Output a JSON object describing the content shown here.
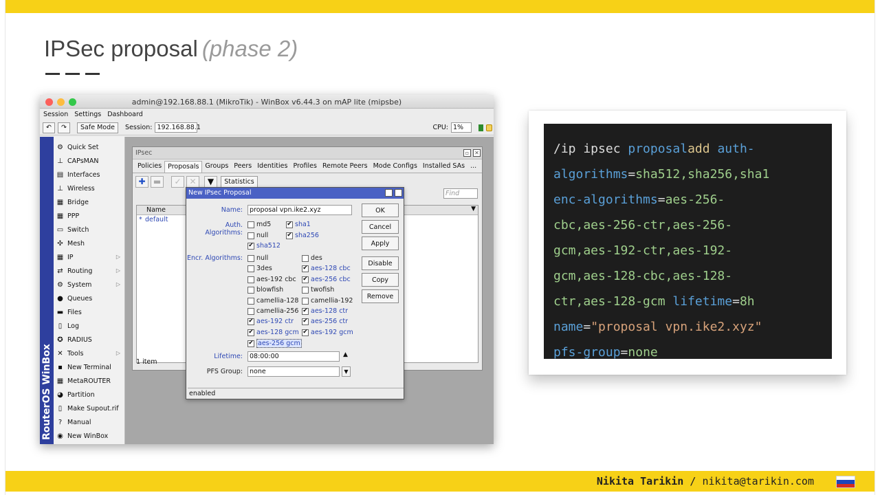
{
  "slide": {
    "title": "IPSec proposal",
    "subtitle": "(phase 2)",
    "footer_name": "Nikita Tarikin",
    "footer_sep": " / ",
    "footer_email": "nikita@tarikin.com",
    "accent_color": "#f7d117",
    "flag_colors": [
      "#ffffff",
      "#1c45b8",
      "#d52b1e"
    ]
  },
  "winbox": {
    "title": "admin@192.168.88.1 (MikroTik) - WinBox v6.44.3 on mAP lite (mipsbe)",
    "menu": [
      "Session",
      "Settings",
      "Dashboard"
    ],
    "safe_mode": "Safe Mode",
    "session_label": "Session:",
    "session_value": "192.168.88.1",
    "cpu_label": "CPU:",
    "cpu_value": "1%",
    "sidebar_brand": "RouterOS WinBox",
    "sidebar_items": [
      {
        "label": "Quick Set",
        "icon": "quickset-icon",
        "glyph": "⚙",
        "arrow": false
      },
      {
        "label": "CAPsMAN",
        "icon": "capsman-icon",
        "glyph": "⊥",
        "arrow": false
      },
      {
        "label": "Interfaces",
        "icon": "interfaces-icon",
        "glyph": "▤",
        "arrow": false
      },
      {
        "label": "Wireless",
        "icon": "wireless-icon",
        "glyph": "⊥",
        "arrow": false
      },
      {
        "label": "Bridge",
        "icon": "bridge-icon",
        "glyph": "▦",
        "arrow": false
      },
      {
        "label": "PPP",
        "icon": "ppp-icon",
        "glyph": "▦",
        "arrow": false
      },
      {
        "label": "Switch",
        "icon": "switch-icon",
        "glyph": "▭",
        "arrow": false
      },
      {
        "label": "Mesh",
        "icon": "mesh-icon",
        "glyph": "✣",
        "arrow": false
      },
      {
        "label": "IP",
        "icon": "ip-icon",
        "glyph": "▦",
        "arrow": true
      },
      {
        "label": "Routing",
        "icon": "routing-icon",
        "glyph": "⇄",
        "arrow": true
      },
      {
        "label": "System",
        "icon": "system-icon",
        "glyph": "⚙",
        "arrow": true
      },
      {
        "label": "Queues",
        "icon": "queues-icon",
        "glyph": "●",
        "arrow": false
      },
      {
        "label": "Files",
        "icon": "files-icon",
        "glyph": "▬",
        "arrow": false
      },
      {
        "label": "Log",
        "icon": "log-icon",
        "glyph": "▯",
        "arrow": false
      },
      {
        "label": "RADIUS",
        "icon": "radius-icon",
        "glyph": "✪",
        "arrow": false
      },
      {
        "label": "Tools",
        "icon": "tools-icon",
        "glyph": "✕",
        "arrow": true
      },
      {
        "label": "New Terminal",
        "icon": "terminal-icon",
        "glyph": "▪",
        "arrow": false
      },
      {
        "label": "MetaROUTER",
        "icon": "metarouter-icon",
        "glyph": "▦",
        "arrow": false
      },
      {
        "label": "Partition",
        "icon": "partition-icon",
        "glyph": "◕",
        "arrow": false
      },
      {
        "label": "Make Supout.rif",
        "icon": "supout-icon",
        "glyph": "▯",
        "arrow": false
      },
      {
        "label": "Manual",
        "icon": "manual-icon",
        "glyph": "?",
        "arrow": false
      },
      {
        "label": "New WinBox",
        "icon": "newwinbox-icon",
        "glyph": "◉",
        "arrow": false
      }
    ]
  },
  "ipsec": {
    "title": "IPsec",
    "tabs": [
      "Policies",
      "Proposals",
      "Groups",
      "Peers",
      "Identities",
      "Profiles",
      "Remote Peers",
      "Mode Configs",
      "Installed SAs",
      "..."
    ],
    "active_tab": "Proposals",
    "statistics": "Statistics",
    "find_placeholder": "Find",
    "col_name": "Name",
    "row_marker": "*",
    "row_name": "default",
    "count": "1 item"
  },
  "dialog": {
    "title": "New IPsec Proposal",
    "name_label": "Name:",
    "name_value": "proposal vpn.ike2.xyz",
    "auth_label": "Auth. Algorithms:",
    "auth": [
      {
        "label": "md5",
        "checked": false
      },
      {
        "label": "sha1",
        "checked": true
      },
      {
        "label": "null",
        "checked": false
      },
      {
        "label": "sha256",
        "checked": true
      },
      {
        "label": "sha512",
        "checked": true
      }
    ],
    "encr_label": "Encr. Algorithms:",
    "encr": [
      {
        "label": "null",
        "checked": false
      },
      {
        "label": "des",
        "checked": false
      },
      {
        "label": "3des",
        "checked": false
      },
      {
        "label": "aes-128 cbc",
        "checked": true
      },
      {
        "label": "aes-192 cbc",
        "checked": false
      },
      {
        "label": "aes-256 cbc",
        "checked": true
      },
      {
        "label": "blowfish",
        "checked": false
      },
      {
        "label": "twofish",
        "checked": false
      },
      {
        "label": "camellia-128",
        "checked": false
      },
      {
        "label": "camellia-192",
        "checked": false
      },
      {
        "label": "camellia-256",
        "checked": false
      },
      {
        "label": "aes-128 ctr",
        "checked": true
      },
      {
        "label": "aes-192 ctr",
        "checked": true
      },
      {
        "label": "aes-256 ctr",
        "checked": true
      },
      {
        "label": "aes-128 gcm",
        "checked": true
      },
      {
        "label": "aes-192 gcm",
        "checked": true
      },
      {
        "label": "aes-256 gcm",
        "checked": true
      }
    ],
    "lifetime_label": "Lifetime:",
    "lifetime_value": "08:00:00",
    "pfs_label": "PFS Group:",
    "pfs_value": "none",
    "buttons": [
      "OK",
      "Cancel",
      "Apply",
      "Disable",
      "Copy",
      "Remove"
    ],
    "status": "enabled"
  },
  "code": {
    "lines": [
      [
        {
          "t": "/ip ipsec ",
          "c": "kw"
        },
        {
          "t": "proposal",
          "c": "prop"
        },
        {
          "t": "add ",
          "c": "gold"
        },
        {
          "t": "auth-",
          "c": "prop"
        }
      ],
      [
        {
          "t": "algorithms",
          "c": "prop"
        },
        {
          "t": "=",
          "c": "op"
        },
        {
          "t": "sha512,sha256,sha1",
          "c": "val"
        }
      ],
      [
        {
          "t": "enc-algorithms",
          "c": "prop"
        },
        {
          "t": "=",
          "c": "op"
        },
        {
          "t": "aes-256-",
          "c": "val"
        }
      ],
      [
        {
          "t": "cbc,aes-256-ctr,aes-256-",
          "c": "val"
        }
      ],
      [
        {
          "t": "gcm,aes-192-ctr,aes-192-",
          "c": "val"
        }
      ],
      [
        {
          "t": "gcm,aes-128-cbc,aes-128-",
          "c": "val"
        }
      ],
      [
        {
          "t": "ctr,aes-128-gcm ",
          "c": "val"
        },
        {
          "t": "lifetime",
          "c": "prop"
        },
        {
          "t": "=",
          "c": "op"
        },
        {
          "t": "8h",
          "c": "val"
        }
      ],
      [
        {
          "t": "name",
          "c": "prop"
        },
        {
          "t": "=",
          "c": "op"
        },
        {
          "t": "\"proposal vpn.ike2.xyz\"",
          "c": "str"
        }
      ],
      [
        {
          "t": "pfs-group",
          "c": "prop"
        },
        {
          "t": "=",
          "c": "op"
        },
        {
          "t": "none",
          "c": "val"
        }
      ]
    ]
  }
}
